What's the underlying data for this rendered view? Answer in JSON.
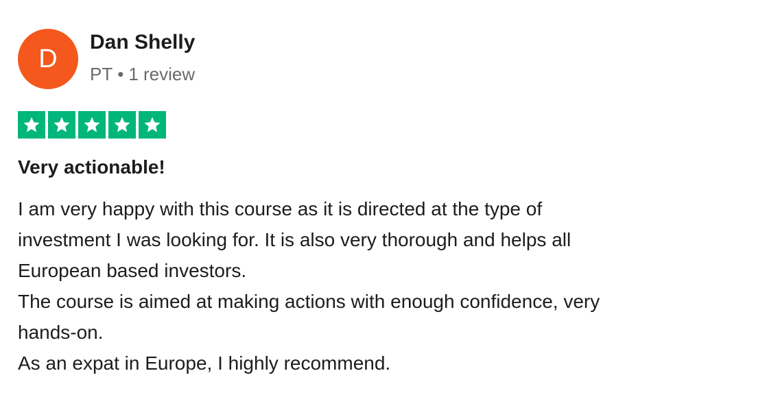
{
  "reviewer": {
    "avatar_initial": "D",
    "avatar_color": "#f4581d",
    "name": "Dan Shelly",
    "country": "PT",
    "separator": "•",
    "review_count": "1 review"
  },
  "rating": {
    "stars": 5,
    "max_stars": 5,
    "star_color": "#00b67a",
    "icon": "star-icon"
  },
  "review": {
    "title": "Very actionable!",
    "lines": [
      "I am very happy with this course as it is directed at the type of",
      "investment I was looking for. It is also very thorough and helps all",
      "European based investors.",
      "The course is aimed at making actions with enough confidence, very",
      "hands-on.",
      "As an expat in Europe, I highly recommend."
    ]
  }
}
